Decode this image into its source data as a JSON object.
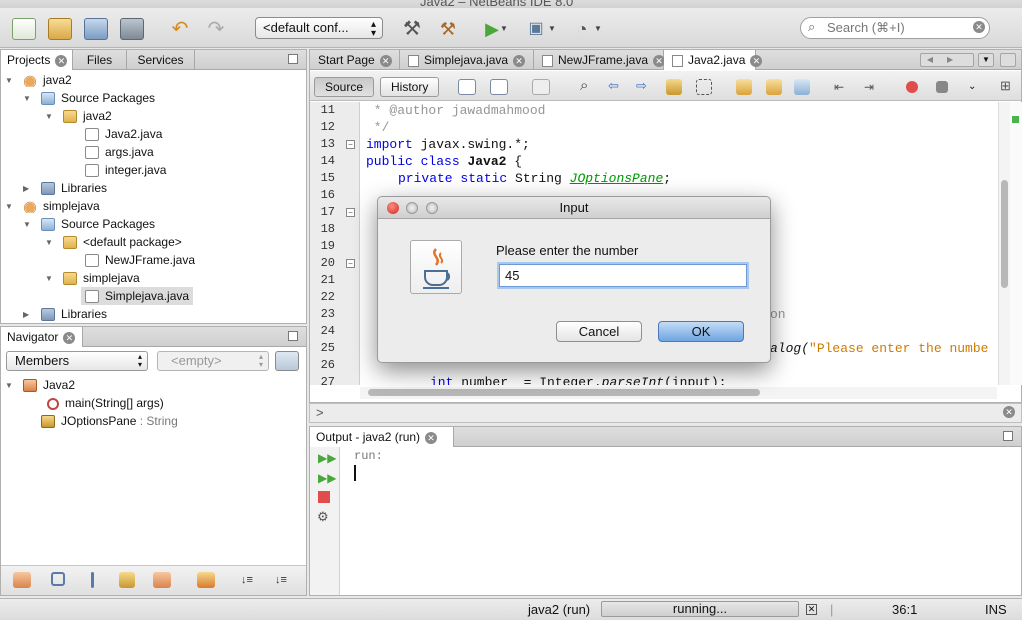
{
  "window": {
    "title": "Java2 – NetBeans IDE 8.0"
  },
  "toolbar": {
    "config_value": "<default conf...",
    "search_placeholder": "Search (⌘+I)"
  },
  "projects_panel": {
    "tabs": [
      "Projects",
      "Files",
      "Services"
    ],
    "tree": [
      {
        "label": "java2",
        "icon": "project-icon",
        "expanded": true
      },
      {
        "label": "Source Packages",
        "icon": "source-packages-icon",
        "expanded": true
      },
      {
        "label": "java2",
        "icon": "package-icon",
        "expanded": true
      },
      {
        "label": "Java2.java",
        "icon": "java-file-icon"
      },
      {
        "label": "args.java",
        "icon": "java-file-icon"
      },
      {
        "label": "integer.java",
        "icon": "java-file-icon"
      },
      {
        "label": "Libraries",
        "icon": "libraries-icon",
        "expanded": false
      },
      {
        "label": "simplejava",
        "icon": "project-icon",
        "expanded": true
      },
      {
        "label": "Source Packages",
        "icon": "source-packages-icon",
        "expanded": true
      },
      {
        "label": "<default package>",
        "icon": "package-icon",
        "expanded": true
      },
      {
        "label": "NewJFrame.java",
        "icon": "java-file-icon"
      },
      {
        "label": "simplejava",
        "icon": "package-icon",
        "expanded": true
      },
      {
        "label": "Simplejava.java",
        "icon": "java-file-icon",
        "selected": true
      },
      {
        "label": "Libraries",
        "icon": "libraries-icon",
        "expanded": false
      }
    ]
  },
  "navigator": {
    "tab": "Navigator",
    "members_select": "Members",
    "filter_select": "<empty>",
    "tree": [
      {
        "label": "Java2",
        "icon": "class-icon"
      },
      {
        "label": "main(String[] args)",
        "icon": "method-icon"
      },
      {
        "label": "JOptionsPane",
        "type": " : String",
        "icon": "field-icon"
      }
    ]
  },
  "editor": {
    "tabs": [
      "Start Page",
      "Simplejava.java",
      "NewJFrame.java",
      "Java2.java"
    ],
    "active_tab": "Java2.java",
    "source_label": "Source",
    "history_label": "History",
    "line_numbers": [
      "11",
      "12",
      "13",
      "14",
      "15",
      "16",
      "17",
      "18",
      "19",
      "20",
      "21",
      "22",
      "23",
      "24",
      "25",
      "26",
      "27"
    ],
    "code": {
      "l11": " * @author jawadmahmood",
      "l12": " */",
      "l13_kw": "import",
      "l13_rest": " javax.swing.*;",
      "l14_kw": "public class",
      "l14_name": "Java2",
      "l14_rest": " {",
      "l15_kw": "private static",
      "l15_type": " String ",
      "l15_field": "JOptionsPane",
      "l15_end": ";",
      "l23_frag": "on",
      "l25_frag": "alog(",
      "l25_str": "\"Please enter the numbe",
      "l27_kw": "int",
      "l27_rest": " number  = Integer.",
      "l27_method": "parseInt",
      "l27_end": "(input);"
    }
  },
  "dialog": {
    "title": "Input",
    "message": "Please enter the number",
    "input_value": "45",
    "cancel_label": "Cancel",
    "ok_label": "OK"
  },
  "output": {
    "tab": "Output - java2 (run)",
    "text": "run:"
  },
  "status_bar": {
    "task": "java2 (run)",
    "progress_label": "running...",
    "position": "36:1",
    "mode": "INS"
  }
}
